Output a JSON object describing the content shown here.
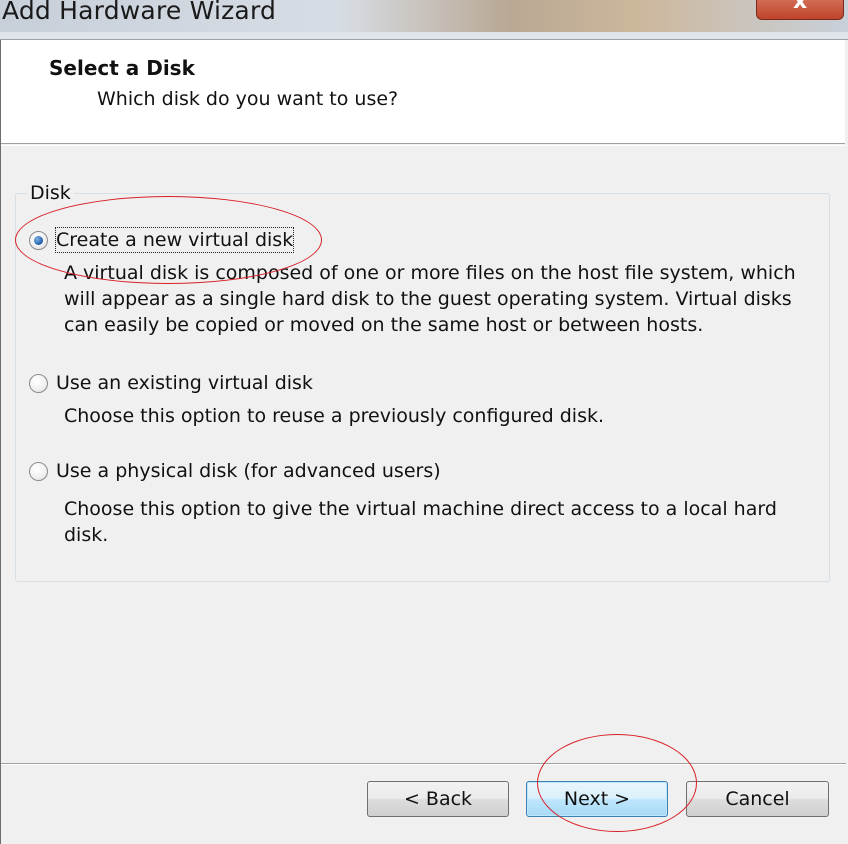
{
  "window": {
    "title": "Add Hardware Wizard",
    "close_glyph": "x"
  },
  "header": {
    "title": "Select a Disk",
    "subtitle": "Which disk do you want to use?"
  },
  "disk_group": {
    "label": "Disk",
    "options": [
      {
        "label": "Create a new virtual disk",
        "checked": true,
        "description": "A virtual disk is composed of one or more files on the host file system, which will appear as a single hard disk to the guest operating system. Virtual disks can easily be copied or moved on the same host or between hosts."
      },
      {
        "label": "Use an existing virtual disk",
        "checked": false,
        "description": "Choose this option to reuse a previously configured disk."
      },
      {
        "label": "Use a physical disk (for advanced users)",
        "checked": false,
        "description": "Choose this option to give the virtual machine direct access to a local hard disk."
      }
    ]
  },
  "buttons": {
    "back": "< Back",
    "next": "Next >",
    "cancel": "Cancel"
  },
  "annotation_color": "#d81f26"
}
